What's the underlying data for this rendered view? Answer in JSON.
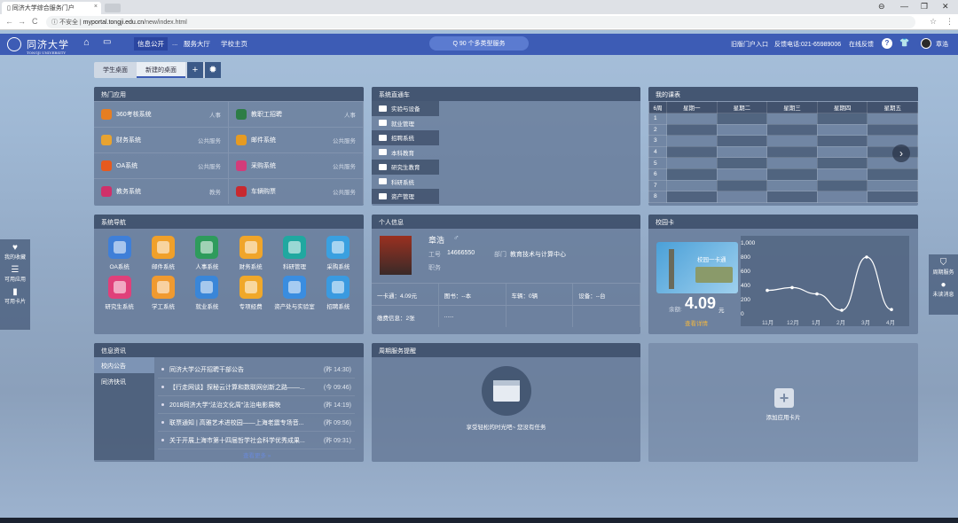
{
  "browser": {
    "tab_title": "同济大学综合服务门户",
    "close": "×",
    "insecure_label": "不安全",
    "url_host": "myportal.tongji.edu.cn",
    "url_path": "/new/index.html",
    "win_min": "—",
    "win_max": "❐",
    "win_close": "✕",
    "back": "←",
    "forward": "→",
    "reload": "C",
    "star": "☆",
    "menu": "⋮",
    "account": "⊖"
  },
  "header": {
    "logo_text": "同济大学",
    "logo_sub": "TONGJI UNIVERSITY",
    "home_icon": "⌂",
    "desktop_icon": "▭",
    "nav": [
      "信息公开",
      "...",
      "服务大厅",
      "学校主页"
    ],
    "search": "Q  90 个多类型服务",
    "old_portal": "旧版门户入口",
    "hotline": "反馈电话:021-65989006",
    "feedback": "在线反馈",
    "help": "?",
    "shirt": "👕",
    "user_name": "章浩"
  },
  "desktop_tabs": [
    "学生桌面",
    "新建的桌面"
  ],
  "desktop_add": "+",
  "desktop_settings": "✹",
  "hot_apps": {
    "title": "热门应用",
    "rows": [
      [
        {
          "name": "360考核系统",
          "cat": "人事",
          "color": "#e67e22"
        },
        {
          "name": "教职工招聘",
          "cat": "人事",
          "color": "#2d7d46"
        }
      ],
      [
        {
          "name": "财务系统",
          "cat": "公共服务",
          "color": "#e8a330"
        },
        {
          "name": "邮件系统",
          "cat": "公共服务",
          "color": "#e69b22"
        }
      ],
      [
        {
          "name": "OA系统",
          "cat": "公共服务",
          "color": "#e65a1f"
        },
        {
          "name": "采购系统",
          "cat": "公共服务",
          "color": "#d33c7a"
        }
      ],
      [
        {
          "name": "教务系统",
          "cat": "教务",
          "color": "#d0306a"
        },
        {
          "name": "车辆购票",
          "cat": "公共服务",
          "color": "#c8292f"
        }
      ]
    ]
  },
  "shortcuts": {
    "title": "系统直通车",
    "items": [
      "实验与设备",
      "就业管理",
      "招聘系统",
      "本科教育",
      "研究生教育",
      "科研系统",
      "资产管理"
    ]
  },
  "schedule": {
    "title": "我的课表",
    "corner": "6周",
    "days": [
      "星期一",
      "星期二",
      "星期三",
      "星期四",
      "星期五"
    ],
    "rows": [
      "1",
      "2",
      "3",
      "4",
      "5",
      "6",
      "7",
      "8"
    ],
    "next_icon": "›"
  },
  "sys_nav": {
    "title": "系统导航",
    "apps": [
      {
        "name": "OA系统",
        "color": "#3f7fd8"
      },
      {
        "name": "邮件系统",
        "color": "#f0a02a"
      },
      {
        "name": "人事系统",
        "color": "#2e9b5c"
      },
      {
        "name": "财务系统",
        "color": "#f0a52a"
      },
      {
        "name": "科研管理",
        "color": "#20a8a0"
      },
      {
        "name": "采购系统",
        "color": "#3aa0e0"
      },
      {
        "name": "研究生系统",
        "color": "#e0407a"
      },
      {
        "name": "学工系统",
        "color": "#f09a30"
      },
      {
        "name": "就业系统",
        "color": "#3a86d8"
      },
      {
        "name": "专项经费",
        "color": "#f0a82a"
      },
      {
        "name": "资产处与实验室",
        "color": "#3a8de0"
      },
      {
        "name": "招聘系统",
        "color": "#3a9ae0"
      }
    ]
  },
  "personal": {
    "title": "个人信息",
    "name": "章浩",
    "gender_icon": "♂",
    "id_label": "工号",
    "id": "14666550",
    "dept_label": "部门",
    "dept": "教育技术与计算中心",
    "role_label": "职务",
    "stats": [
      "一卡通：4.09元",
      "图书：--本",
      "车辆：0辆",
      "设备：--台"
    ],
    "stats2": [
      "缴费信息：2张",
      "......",
      "",
      ""
    ]
  },
  "campus_card": {
    "title": "校园卡",
    "card_label": "校园一卡通",
    "balance_label": "余额:",
    "balance": "4.09",
    "unit": "元",
    "detail_link": "查看详情"
  },
  "chart_data": {
    "type": "line",
    "categories": [
      "11月",
      "12月",
      "1月",
      "2月",
      "3月",
      "4月"
    ],
    "values": [
      330,
      370,
      280,
      50,
      800,
      60
    ],
    "ylim": [
      0,
      1000
    ],
    "yticks": [
      "0",
      "200",
      "400",
      "600",
      "800",
      "1,000"
    ]
  },
  "news": {
    "title": "信息资讯",
    "tabs": [
      "校内公告",
      "同济快讯"
    ],
    "items": [
      {
        "text": "同济大学公开招聘干部公告",
        "time": "(昨 14:30)"
      },
      {
        "text": "【行走网谈】探秘云计算和数联网创新之路——...",
        "time": "(今 09:46)"
      },
      {
        "text": "2018同济大学“法治文化周”法治电影展映",
        "time": "(昨 14:19)"
      },
      {
        "text": "联票通知 | 高雅艺术进校园——上海老震专场音...",
        "time": "(昨 09:56)"
      },
      {
        "text": "关于开展上海市第十四届哲学社会科学优秀成果...",
        "time": "(昨 09:31)"
      }
    ],
    "more": "查看更多 »"
  },
  "weekly": {
    "title": "周期服务提醒",
    "empty_text": "享受轻松的时光吧~ 您没有任务"
  },
  "add_card": {
    "icon": "+",
    "label": "添加应用卡片"
  },
  "left_float": [
    {
      "icon": "♥",
      "label": "我的收藏"
    },
    {
      "icon": "☰",
      "label": "可用应用"
    },
    {
      "icon": "▮",
      "label": "可用卡片"
    }
  ],
  "right_float": [
    {
      "icon": "⛉",
      "label": "周期服务"
    },
    {
      "icon": "●",
      "label": "未读消息"
    }
  ]
}
